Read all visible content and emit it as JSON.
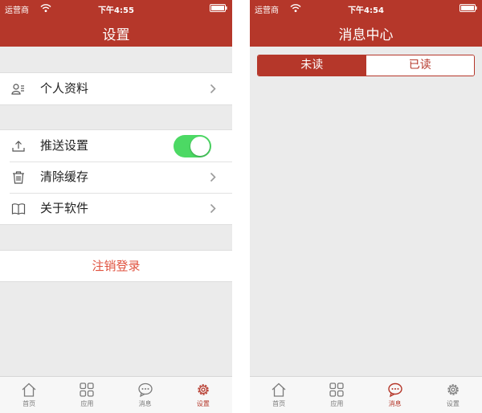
{
  "colors": {
    "brand": "#b5372a",
    "toggle_on": "#4cd964",
    "logout_text": "#e0523f"
  },
  "left": {
    "status": {
      "carrier": "运营商",
      "time": "下午4:55"
    },
    "nav_title": "设置",
    "profile_label": "个人资料",
    "push_label": "推送设置",
    "push_enabled": true,
    "clear_cache_label": "清除缓存",
    "about_label": "关于软件",
    "logout_label": "注销登录",
    "tabs": [
      {
        "label": "首页",
        "icon": "home-icon"
      },
      {
        "label": "应用",
        "icon": "grid-icon"
      },
      {
        "label": "消息",
        "icon": "chat-icon"
      },
      {
        "label": "设置",
        "icon": "gear-icon"
      }
    ],
    "active_tab": "设置"
  },
  "right": {
    "status": {
      "carrier": "运营商",
      "time": "下午4:54"
    },
    "nav_title": "消息中心",
    "segments": [
      "未读",
      "已读"
    ],
    "selected_segment": "未读",
    "tabs": [
      {
        "label": "首页",
        "icon": "home-icon"
      },
      {
        "label": "应用",
        "icon": "grid-icon"
      },
      {
        "label": "消息",
        "icon": "chat-icon"
      },
      {
        "label": "设置",
        "icon": "gear-icon"
      }
    ],
    "active_tab": "消息"
  }
}
